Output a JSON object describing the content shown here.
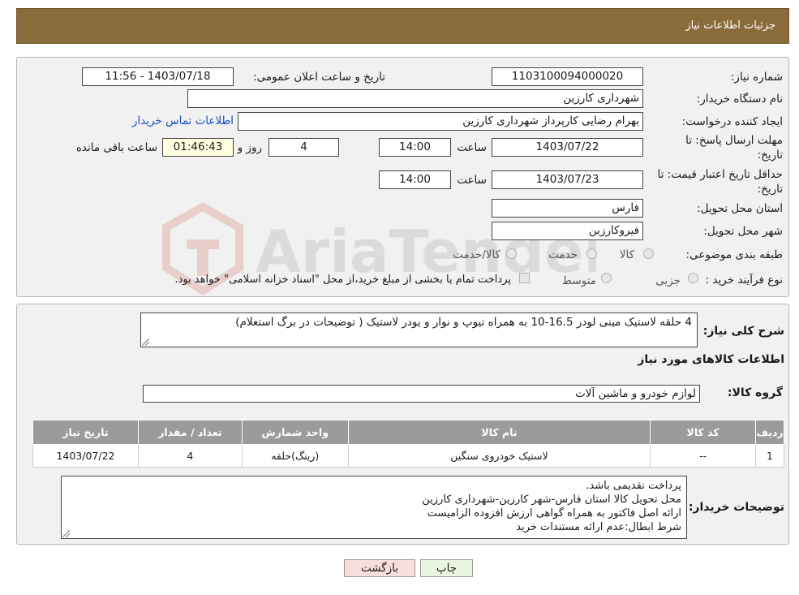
{
  "header": {
    "title": "جزئیات اطلاعات نیاز"
  },
  "form": {
    "need_number_label": "شماره نیاز:",
    "need_number": "1103100094000020",
    "announce_label": "تاریخ و ساعت اعلان عمومی:",
    "announce_value": "1403/07/18 - 11:56",
    "buyer_org_label": "نام دستگاه خریدار:",
    "buyer_org": "شهرداری کارزین",
    "creator_label": "ایجاد کننده درخواست:",
    "creator": "بهرام رضایی کارپرداز شهرداری کارزین",
    "contact_link": "اطلاعات تماس خریدار",
    "deadline_label_1": "مهلت ارسال پاسخ: تا",
    "deadline_label_2": "تاریخ:",
    "deadline_date": "1403/07/22",
    "time_label": "ساعت",
    "deadline_time": "14:00",
    "days_value": "4",
    "days_label": "روز و",
    "remaining_time": "01:46:43",
    "remaining_label": "ساعت باقی مانده",
    "validity_label_1": "حداقل تاریخ اعتبار قیمت: تا",
    "validity_label_2": "تاریخ:",
    "validity_date": "1403/07/23",
    "validity_time_label": "ساعت",
    "validity_time": "14:00",
    "province_label": "استان محل تحویل:",
    "province": "فارس",
    "city_label": "شهر محل تحویل:",
    "city": "فیروکارزین",
    "category_label": "طبقه بندی موضوعی:",
    "category_options": [
      "کالا",
      "خدمت",
      "کالا/خدمت"
    ],
    "process_label": "نوع فرآیند خرید :",
    "process_options": [
      "جزیی",
      "متوسط"
    ],
    "payment_note": "پرداخت تمام یا بخشی از مبلغ خرید،از محل \"اسناد خزانه اسلامی\" خواهد بود."
  },
  "summary": {
    "label": "شرح کلی نیاز:",
    "text": "4 حلقه  لاستیک مینی لودر 16.5-10 به همراه تیوپ و نوار  و یودر لاستیک ( توضیحات در برگ استعلام)",
    "goods_info_title": "اطلاعات کالاهای مورد نیاز",
    "group_label": "گروه کالا:",
    "group_value": "لوازم خودرو و ماشین آلات"
  },
  "table": {
    "headers": [
      "ردیف",
      "کد کالا",
      "نام کالا",
      "واحد شمارش",
      "تعداد / مقدار",
      "تاریخ نیاز"
    ],
    "rows": [
      [
        "1",
        "--",
        "لاستیک خودروی سنگین",
        "(رینگ)حلقه",
        "4",
        "1403/07/22"
      ]
    ]
  },
  "buyer_notes": {
    "label": "توضیحات خریدار:",
    "lines": [
      "پرداخت نقدیمی باشد.",
      "محل تحویل کالا استان فارس-شهر کارزین-شهرداری کارزین",
      "ارائه اصل فاکتور به همراه گواهی ارزش افزوده  الزامیست",
      "شرط ابطال:عدم ارائه مستندات خرید"
    ]
  },
  "buttons": {
    "print": "چاپ",
    "back": "بازگشت"
  },
  "watermark": {
    "text": "AriaTender.neT"
  },
  "colors": {
    "header": "#8a6c3a",
    "back_button": "#f9dcdc",
    "print_button": "#eaf6e2",
    "link": "#1a4fc4"
  }
}
